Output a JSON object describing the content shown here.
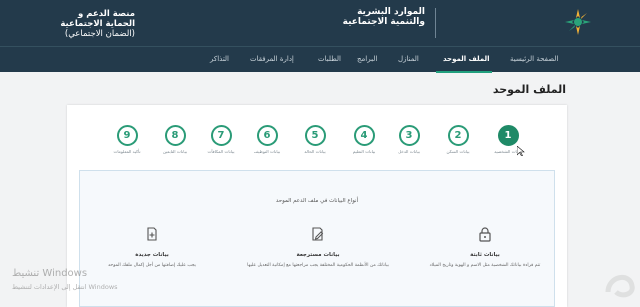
{
  "header": {
    "logo_lines": [
      "الموارد البشرية",
      "والتنمية الاجتماعية"
    ],
    "platform_lines": [
      "منصة الدعم و",
      "الحماية الاجتماعية",
      "(الضمان الاجتماعي)"
    ]
  },
  "nav": {
    "items": [
      {
        "label": "الصفحة الرئيسية",
        "active": false
      },
      {
        "label": "الملف الموحد",
        "active": true
      },
      {
        "label": "المنازل",
        "active": false
      },
      {
        "label": "البرامج",
        "active": false
      },
      {
        "label": "الطلبات",
        "active": false
      },
      {
        "label": "إدارة المرفقات",
        "active": false
      },
      {
        "label": "التذاكر",
        "active": false
      }
    ]
  },
  "page_title": "الملف الموحد",
  "steps": [
    {
      "num": "1",
      "label": "بيانات الشخصية",
      "active": true
    },
    {
      "num": "2",
      "label": "بيانات السكن",
      "active": false
    },
    {
      "num": "3",
      "label": "بيانات الدخل",
      "active": false
    },
    {
      "num": "4",
      "label": "بيانات التعليم",
      "active": false
    },
    {
      "num": "5",
      "label": "بيانات الحالة",
      "active": false
    },
    {
      "num": "6",
      "label": "بيانات التوظيف",
      "active": false
    },
    {
      "num": "7",
      "label": "بيانات المكافآت",
      "active": false
    },
    {
      "num": "8",
      "label": "بيانات التابعين",
      "active": false
    },
    {
      "num": "9",
      "label": "تأكيد المعلومات",
      "active": false
    }
  ],
  "info": {
    "title": "أنواع البيانات في ملف الدعم الموحد",
    "columns": [
      {
        "icon": "lock-icon",
        "heading": "بيانات ثابتة",
        "desc": "تتم قراءة بياناتك الشخصية مثل الاسم و الهوية وتاريخ الميلاد"
      },
      {
        "icon": "edit-document-icon",
        "heading": "بيانات مسترجعة",
        "desc": "بياناتك من الأنظمة الحكومية المختلفة يجب مراجعتها مع إمكانية التعديل عليها"
      },
      {
        "icon": "add-document-icon",
        "heading": "بيانات جديدة",
        "desc": "يجب عليك إضافتها من أجل إكمال ملفك الموحد"
      }
    ]
  },
  "windows_watermark": {
    "line1": "تنشيط Windows",
    "line2": "انتقل إلى الإعدادات لتنشيط Windows"
  },
  "colors": {
    "header_bg": "#233a4b",
    "accent": "#22a07e",
    "step_green": "#2a9b77"
  }
}
